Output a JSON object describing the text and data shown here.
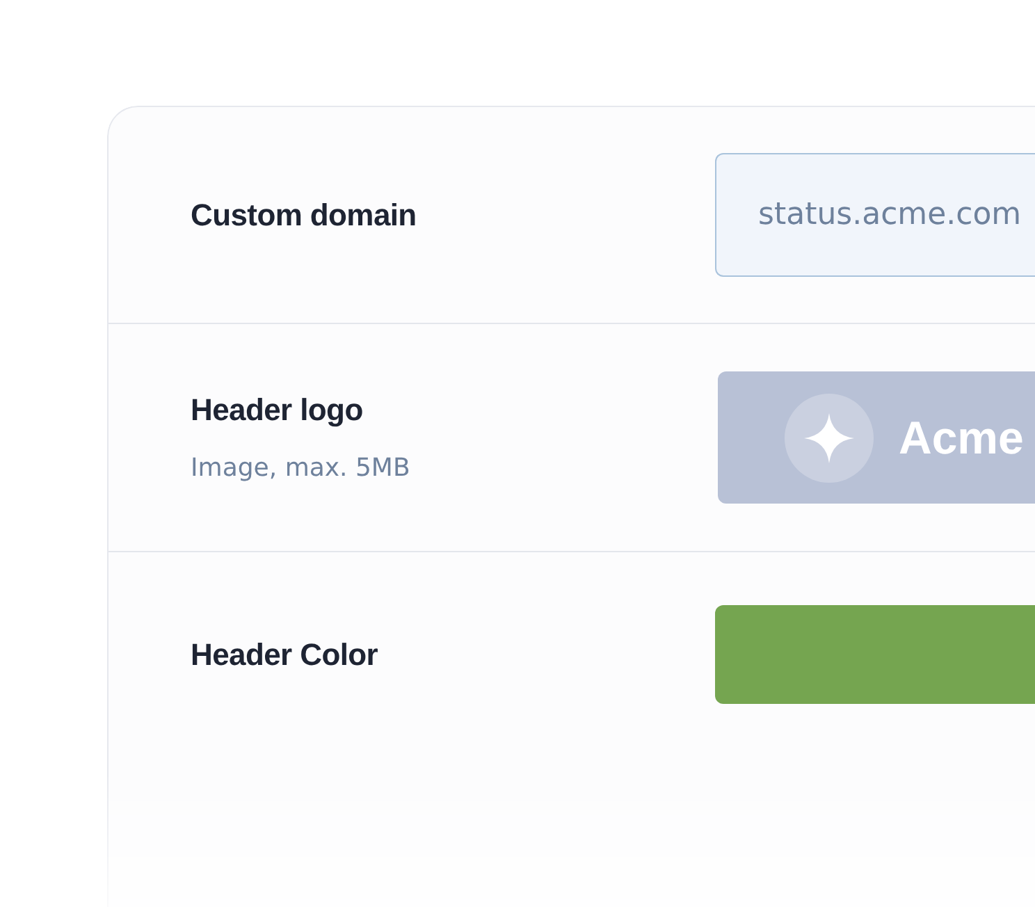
{
  "settings": [
    {
      "kind": "text_field",
      "label": "Custom domain",
      "value": "status.acme.com"
    },
    {
      "kind": "logo_upload",
      "label": "Header logo",
      "hint": "Image, max. 5MB",
      "logo_text": "Acme"
    },
    {
      "kind": "color",
      "label": "Header Color",
      "color": "#75a550"
    }
  ]
}
